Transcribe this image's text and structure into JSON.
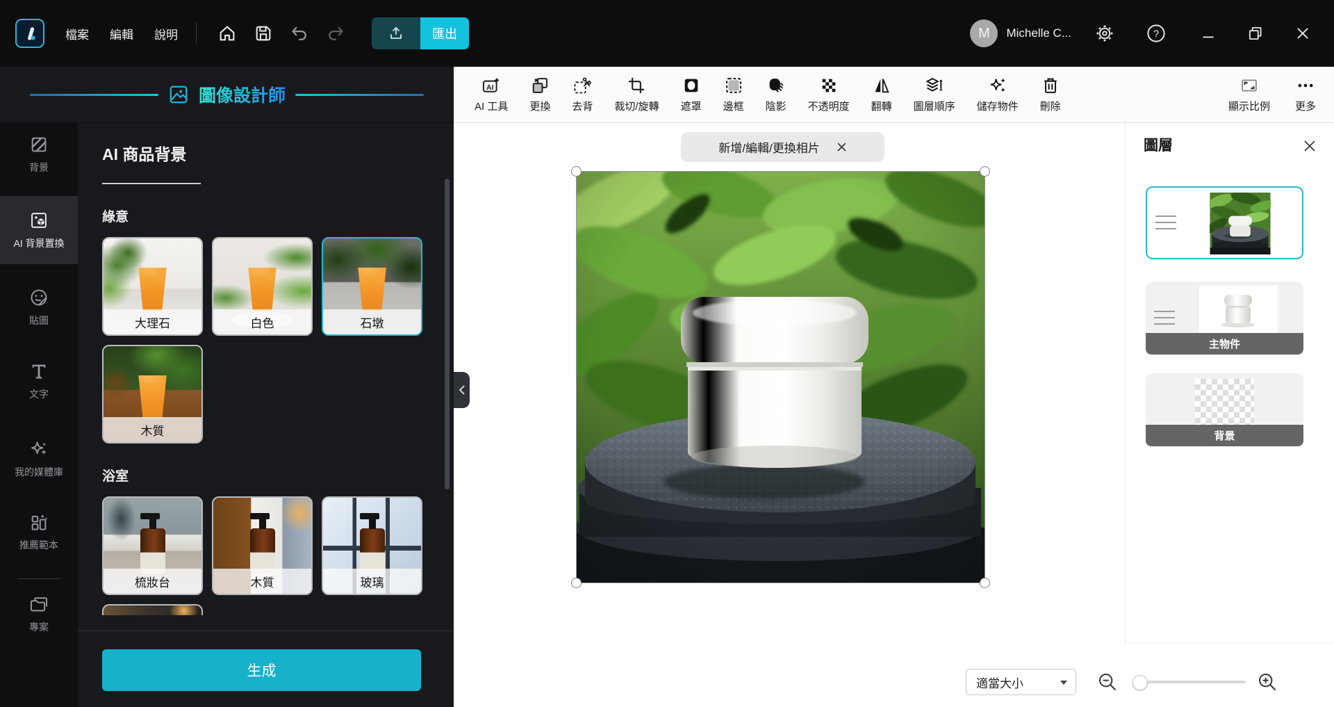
{
  "topbar": {
    "menus": [
      "檔案",
      "編輯",
      "說明"
    ],
    "export_label": "匯出",
    "user": {
      "initial": "M",
      "name": "Michelle C..."
    }
  },
  "left_header": {
    "title": "圖像設計師"
  },
  "sidebar": {
    "items": [
      {
        "label": "背景",
        "active": false
      },
      {
        "label": "AI 背景置換",
        "active": true
      },
      {
        "label": "貼圖",
        "active": false
      },
      {
        "label": "文字",
        "active": false
      },
      {
        "label": "我的媒體庫",
        "active": false
      },
      {
        "label": "推薦範本",
        "active": false
      },
      {
        "label": "專案",
        "active": false
      }
    ]
  },
  "panel": {
    "title": "AI 商品背景",
    "sections": [
      {
        "name": "綠意",
        "items": [
          {
            "label": "大理石",
            "selected": false
          },
          {
            "label": "白色",
            "selected": false
          },
          {
            "label": "石墩",
            "selected": true
          },
          {
            "label": "木質",
            "selected": false
          }
        ]
      },
      {
        "name": "浴室",
        "items": [
          {
            "label": "梳妝台",
            "selected": false
          },
          {
            "label": "木質",
            "selected": false
          },
          {
            "label": "玻璃",
            "selected": false
          }
        ]
      }
    ],
    "generate_label": "生成"
  },
  "toolbar": {
    "items": [
      "AI 工具",
      "更換",
      "去背",
      "裁切/旋轉",
      "遮罩",
      "邊框",
      "陰影",
      "不透明度",
      "翻轉",
      "圖層順序",
      "儲存物件",
      "刪除"
    ],
    "right_items": [
      "顯示比例",
      "更多"
    ]
  },
  "canvas": {
    "banner": "新增/編輯/更換相片"
  },
  "layers": {
    "title": "圖層",
    "items": [
      {
        "label": "",
        "selected": true
      },
      {
        "label": "主物件",
        "selected": false
      },
      {
        "label": "背景",
        "selected": false
      }
    ]
  },
  "statusbar": {
    "zoom_preset": "適當大小"
  },
  "colors": {
    "accent": "#14c2de",
    "generate": "#17b1cc",
    "selected_border": "#29b8d4",
    "topbar_bg": "#0d0d0e",
    "panel_bg": "#17191c"
  }
}
